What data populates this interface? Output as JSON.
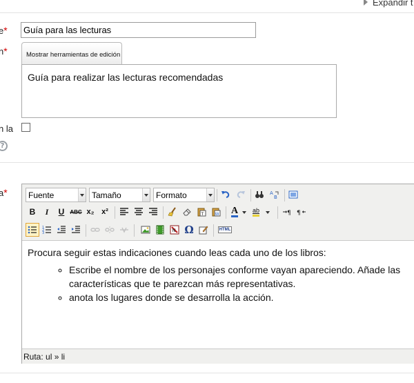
{
  "header": {
    "expand_label": "Expandir t"
  },
  "fields": {
    "name": {
      "label_tail": "e",
      "value": "Guía para las lecturas"
    },
    "description": {
      "label_tail": "n",
      "toggle_label": "Mostrar herramientas de edición",
      "value": "Guía para realizar las lecturas recomendadas"
    },
    "show_description": {
      "label_tail": "n la",
      "checked": false
    },
    "content": {
      "label_tail": "a"
    }
  },
  "required_mark": "*",
  "help_glyph": "?",
  "editor": {
    "font_select": "Fuente",
    "size_select": "Tamaño",
    "format_select": "Formato",
    "bold_label": "B",
    "italic_label": "I",
    "underline_label": "U",
    "strike_label": "ABC",
    "subscript_label": "x₂",
    "superscript_label": "x²",
    "font_color_label": "A",
    "highlight_label": "ab",
    "html_label": "HTML",
    "intro": "Procura seguir estas indicaciones cuando leas cada uno de los libros:",
    "items": [
      "Escribe el nombre de los personajes conforme vayan apareciendo. Añade las características que te parezcan más representativas.",
      "anota los lugares donde se desarrolla la acción."
    ],
    "path_label": "Ruta:",
    "path_value": "ul » li"
  },
  "colors": {
    "required": "#d10000",
    "active_button_border": "#e0a53a",
    "active_button_bg": "#fff3c5",
    "toolbar_bg": "#f0f0ee"
  }
}
